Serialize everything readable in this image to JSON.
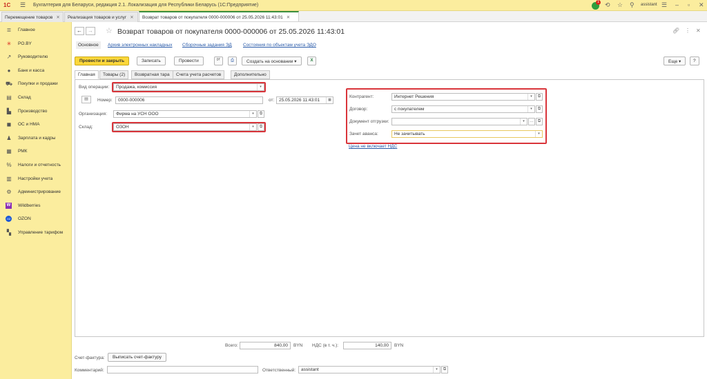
{
  "titlebar": {
    "logo": "1С",
    "app_title": "Бухгалтерия для Беларуси, редакция 2.1. Локализация для Республики Беларусь  (1С:Предприятие)",
    "notification_count": "1",
    "user": "assistant"
  },
  "open_tabs": [
    {
      "label": "Перемещение товаров"
    },
    {
      "label": "Реализация товаров и услуг"
    },
    {
      "label": "Возврат товаров от покупателя 0000-000006 от 25.05.2026 11:43:01"
    }
  ],
  "sidebar": {
    "items": [
      {
        "label": "Главное",
        "icon": "menu-icon"
      },
      {
        "label": "PO.BY",
        "icon": "star-icon"
      },
      {
        "label": "Руководителю",
        "icon": "chart-icon"
      },
      {
        "label": "Банк и касса",
        "icon": "bank-icon"
      },
      {
        "label": "Покупки и продажи",
        "icon": "cart-icon"
      },
      {
        "label": "Склад",
        "icon": "warehouse-icon"
      },
      {
        "label": "Производство",
        "icon": "factory-icon"
      },
      {
        "label": "ОС и НМА",
        "icon": "truck-icon"
      },
      {
        "label": "Зарплата и кадры",
        "icon": "person-icon"
      },
      {
        "label": "РМК",
        "icon": "register-icon"
      },
      {
        "label": "Налоги и отчетность",
        "icon": "tax-icon"
      },
      {
        "label": "Настройки учета",
        "icon": "settings-list-icon"
      },
      {
        "label": "Администрирование",
        "icon": "gear-icon"
      },
      {
        "label": "Wildberries",
        "icon": "wildberries-icon",
        "glyph": "W"
      },
      {
        "label": "OZON",
        "icon": "ozon-icon",
        "glyph": "OZ"
      },
      {
        "label": "Управление тарифом",
        "icon": "tariff-icon"
      }
    ]
  },
  "document": {
    "title": "Возврат товаров от покупателя 0000-000006 от 25.05.2026 11:43:01",
    "subnav": [
      "Основное",
      "Архив электронных накладных",
      "Сборочные задания ЭД",
      "Состояния по объектам учета ЭДО"
    ],
    "toolbar": {
      "post_close": "Провести и закрыть",
      "save": "Записать",
      "post": "Провести",
      "create_based": "Создать на основании",
      "more": "Еще",
      "help": "?"
    },
    "form_tabs": [
      "Главная",
      "Товары (2)",
      "Возвратная тара",
      "Счета учета расчетов",
      "Дополнительно"
    ],
    "fields": {
      "operation_type_label": "Вид операции:",
      "operation_type": "Продажа, комиссия",
      "number_label": "Номер:",
      "number": "0000-000006",
      "date_label": "от:",
      "date": "25.05.2026 11:43:01",
      "organization_label": "Организация:",
      "organization": "Фирма на УСН ООО",
      "warehouse_label": "Склад:",
      "warehouse": "ОЗОН",
      "counterparty_label": "Контрагент:",
      "counterparty": "Интернет Решения",
      "contract_label": "Договор:",
      "contract": "с покупателем",
      "shipping_doc_label": "Документ отгрузки:",
      "shipping_doc": "",
      "advance_label": "Зачет аванса:",
      "advance": "Не зачитывать",
      "vat_link": "Цена не включает НДС"
    },
    "totals": {
      "total_label": "Всего:",
      "total": "840,00",
      "currency": "BYN",
      "vat_label": "НДС (в т. ч.):",
      "vat": "140,00"
    },
    "invoice": {
      "label": "Счет-фактура:",
      "button": "Выписать счет-фактуру"
    },
    "comment": {
      "label": "Комментарий:",
      "value": ""
    },
    "responsible": {
      "label": "Ответственный:",
      "value": "assistant"
    }
  },
  "colors": {
    "accent_yellow": "#fbed9e",
    "primary_button": "#fcd73a",
    "highlight_red": "#d9343a",
    "link_blue": "#2658a8"
  }
}
